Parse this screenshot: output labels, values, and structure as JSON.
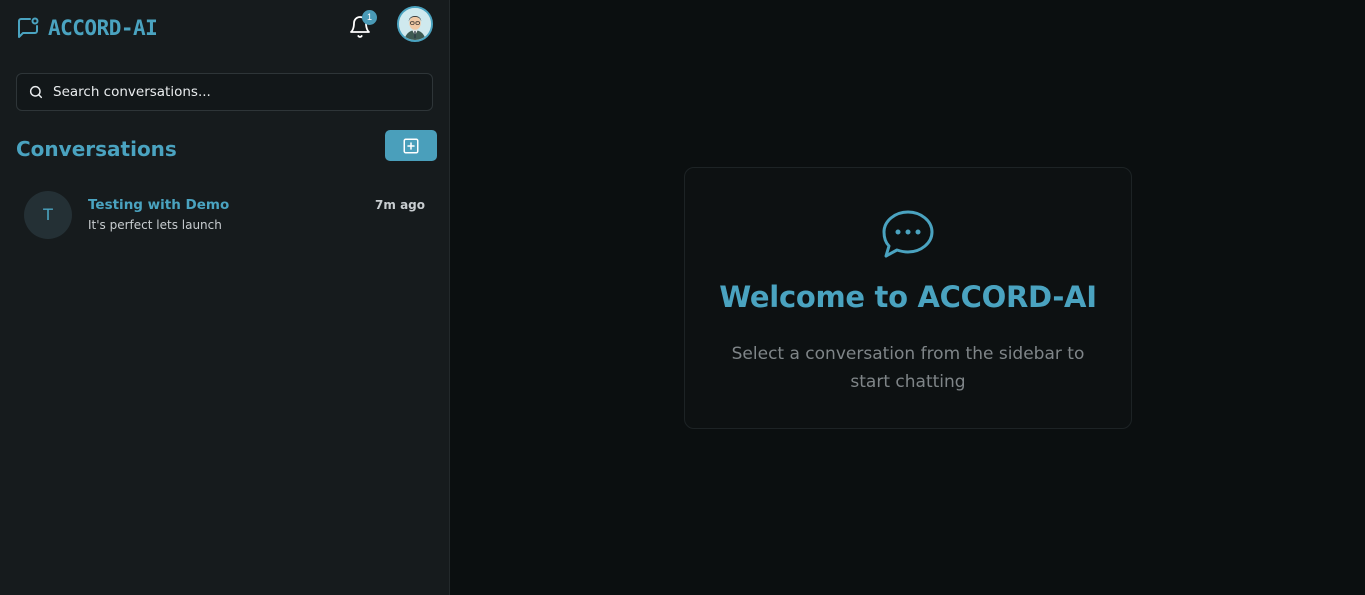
{
  "brand": {
    "name": "ACCORD-AI",
    "icon": "message-icon"
  },
  "header": {
    "notifications": {
      "icon": "bell-icon",
      "count": "1"
    },
    "avatar": {
      "icon": "user-avatar"
    }
  },
  "search": {
    "placeholder": "Search conversations...",
    "icon": "search-icon"
  },
  "sidebar": {
    "title": "Conversations",
    "new_button_icon": "plus-square-icon",
    "conversations": [
      {
        "initial": "T",
        "name": "Testing with Demo",
        "time": "7m ago",
        "preview": "It's perfect lets launch"
      }
    ]
  },
  "welcome": {
    "icon": "chat-bubble-icon",
    "title": "Welcome to ACCORD-AI",
    "subtitle": "Select a conversation from the sidebar to start chatting"
  },
  "colors": {
    "accent": "#4aa3c0",
    "sidebar_bg": "#161b1d",
    "main_bg": "#0b0f10"
  }
}
